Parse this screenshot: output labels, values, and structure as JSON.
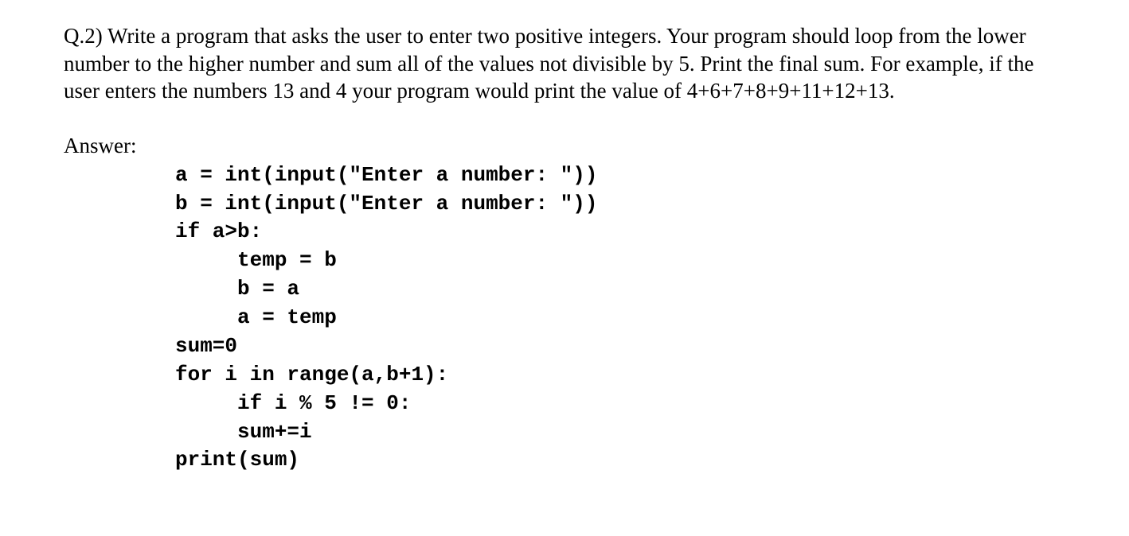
{
  "question": {
    "text": "Q.2) Write a program that asks the user to enter two positive integers. Your program should loop from the lower number to the higher number and sum all of the values not divisible by 5. Print the final sum. For example, if the user enters the numbers 13 and 4 your program would print the value of  4+6+7+8+9+11+12+13."
  },
  "answer": {
    "label": "Answer:",
    "code": "a = int(input(\"Enter a number: \"))\nb = int(input(\"Enter a number: \"))\nif a>b:\n     temp = b\n     b = a\n     a = temp\nsum=0\nfor i in range(a,b+1):\n     if i % 5 != 0:\n     sum+=i\nprint(sum)"
  }
}
